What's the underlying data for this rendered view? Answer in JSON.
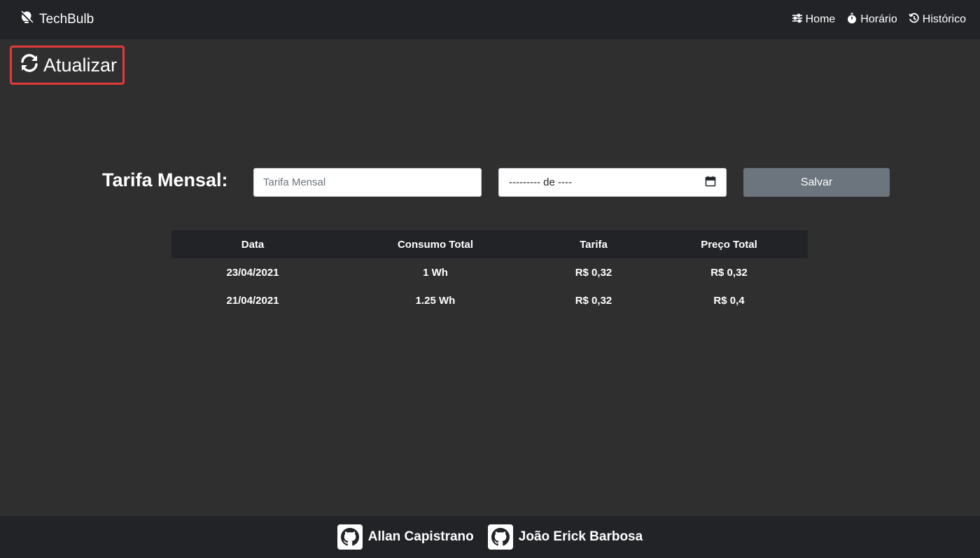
{
  "navbar": {
    "brand": "TechBulb",
    "brand_icon": "lightbulb-off-icon",
    "links": [
      {
        "label": "Home",
        "icon": "sliders-icon"
      },
      {
        "label": "Horário",
        "icon": "stopwatch-icon"
      },
      {
        "label": "Histórico",
        "icon": "history-icon"
      }
    ]
  },
  "refresh": {
    "label": "Atualizar",
    "icon": "sync-icon",
    "highlight_color": "#e03b3b"
  },
  "form": {
    "label": "Tarifa Mensal:",
    "tarifa_placeholder": "Tarifa Mensal",
    "month_value": "--------- de ----",
    "save_label": "Salvar"
  },
  "table": {
    "headers": [
      "Data",
      "Consumo Total",
      "Tarifa",
      "Preço Total"
    ],
    "rows": [
      [
        "23/04/2021",
        "1 Wh",
        "R$ 0,32",
        "R$ 0,32"
      ],
      [
        "21/04/2021",
        "1.25 Wh",
        "R$ 0,32",
        "R$ 0,4"
      ]
    ]
  },
  "footer": {
    "authors": [
      "Allan Capistrano",
      "João Erick Barbosa"
    ],
    "icon": "github-icon"
  },
  "colors": {
    "background": "#2f2f2f",
    "bar": "#212327",
    "button_secondary": "#6c757d"
  }
}
